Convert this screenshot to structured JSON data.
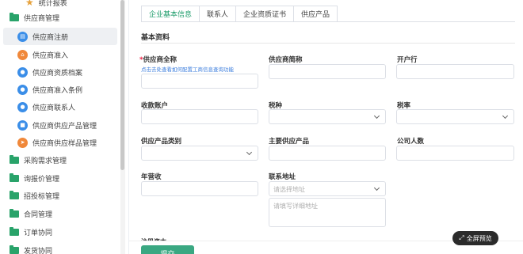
{
  "sidebar": {
    "top_item": "统计报表",
    "items": [
      {
        "label": "供应商管理",
        "type": "folder"
      },
      {
        "label": "供应商注册",
        "type": "sub",
        "icon": "document-icon",
        "color": "#3b8ee8",
        "active": true
      },
      {
        "label": "供应商准入",
        "type": "sub",
        "icon": "home-icon",
        "color": "#f0883a"
      },
      {
        "label": "供应商资质档案",
        "type": "sub",
        "icon": "user-icon",
        "color": "#3b8ee8"
      },
      {
        "label": "供应商准入条例",
        "type": "sub",
        "icon": "user-icon",
        "color": "#3b8ee8"
      },
      {
        "label": "供应商联系人",
        "type": "sub",
        "icon": "user-icon",
        "color": "#3b8ee8"
      },
      {
        "label": "供应商供应产品管理",
        "type": "sub",
        "icon": "gift-icon",
        "color": "#3b8ee8"
      },
      {
        "label": "供应商供应样品管理",
        "type": "sub",
        "icon": "send-icon",
        "color": "#f0883a"
      },
      {
        "label": "采购需求管理",
        "type": "folder"
      },
      {
        "label": "询报价管理",
        "type": "folder"
      },
      {
        "label": "招投标管理",
        "type": "folder"
      },
      {
        "label": "合同管理",
        "type": "folder"
      },
      {
        "label": "订单协同",
        "type": "folder"
      },
      {
        "label": "发货协同",
        "type": "folder"
      }
    ]
  },
  "tabs": [
    "企业基本信息",
    "联系人",
    "企业资质证书",
    "供应产品"
  ],
  "section_title": "基本资料",
  "form": {
    "supplier_full_name": {
      "label": "供应商全称",
      "required_mark": "*",
      "hint": "点击去处查看如何配置工商信息查询功能"
    },
    "supplier_short_name": {
      "label": "供应商简称"
    },
    "bank": {
      "label": "开户行"
    },
    "account": {
      "label": "收款账户"
    },
    "tax_type": {
      "label": "税种"
    },
    "tax_rate": {
      "label": "税率"
    },
    "product_category": {
      "label": "供应产品类别"
    },
    "main_product": {
      "label": "主要供应产品"
    },
    "headcount": {
      "label": "公司人数"
    },
    "annual_revenue": {
      "label": "年营收"
    },
    "address": {
      "label": "联系地址",
      "select_placeholder": "请选择地址",
      "detail_placeholder": "请填写详细地址"
    },
    "cut_label": "注册资本"
  },
  "submit_label": "提交",
  "preview_label": "全屏预览",
  "colors": {
    "accent": "#1e9d6b",
    "button": "#3aa882",
    "folder": "#29a36a"
  }
}
